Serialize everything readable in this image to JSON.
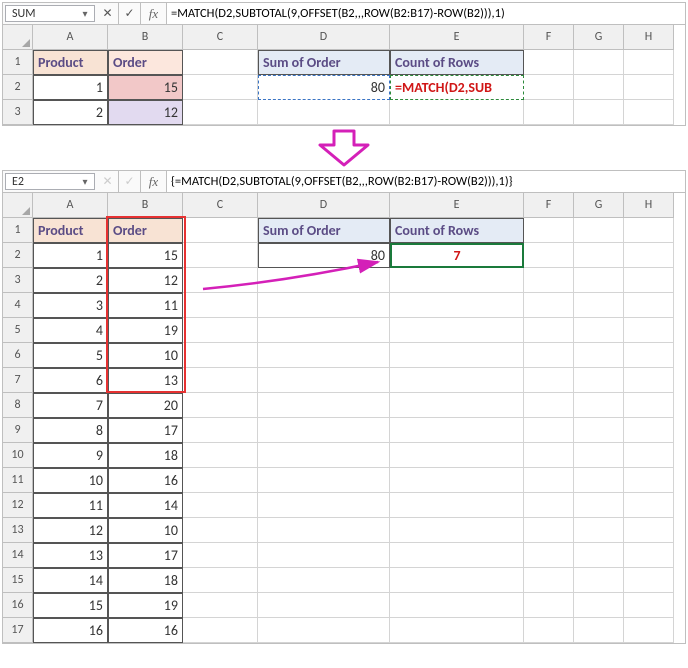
{
  "top": {
    "name_box": "SUM",
    "formula": "=MATCH(D2,SUBTOTAL(9,OFFSET(B2,,,ROW(B2:B17)-ROW(B2))),1)",
    "cols": [
      "A",
      "B",
      "C",
      "D",
      "E",
      "F",
      "G",
      "H"
    ],
    "rows": [
      "1",
      "2",
      "3"
    ],
    "headers": {
      "A1": "Product",
      "B1": "Order",
      "D1": "Sum of Order",
      "E1": "Count of Rows"
    },
    "data": {
      "A2": "1",
      "B2": "15",
      "A3": "2",
      "B3": "12",
      "D2": "80",
      "E2": "=MATCH(D2,SUB"
    }
  },
  "bottom": {
    "name_box": "E2",
    "formula": "{=MATCH(D2,SUBTOTAL(9,OFFSET(B2,,,ROW(B2:B17)-ROW(B2))),1)}",
    "cols": [
      "A",
      "B",
      "C",
      "D",
      "E",
      "F",
      "G",
      "H"
    ],
    "rows": [
      "1",
      "2",
      "3",
      "4",
      "5",
      "6",
      "7",
      "8",
      "9",
      "10",
      "11",
      "12",
      "13",
      "14",
      "15",
      "16",
      "17"
    ],
    "headers": {
      "A1": "Product",
      "B1": "Order",
      "D1": "Sum of Order",
      "E1": "Count of Rows"
    },
    "product": [
      "1",
      "2",
      "3",
      "4",
      "5",
      "6",
      "7",
      "8",
      "9",
      "10",
      "11",
      "12",
      "13",
      "14",
      "15",
      "16"
    ],
    "order": [
      "15",
      "12",
      "11",
      "19",
      "10",
      "13",
      "20",
      "17",
      "18",
      "16",
      "14",
      "10",
      "17",
      "18",
      "19",
      "16"
    ],
    "D2": "80",
    "E2": "7"
  },
  "icons": {
    "cancel": "✕",
    "accept": "✓",
    "dropdown": "▾"
  }
}
